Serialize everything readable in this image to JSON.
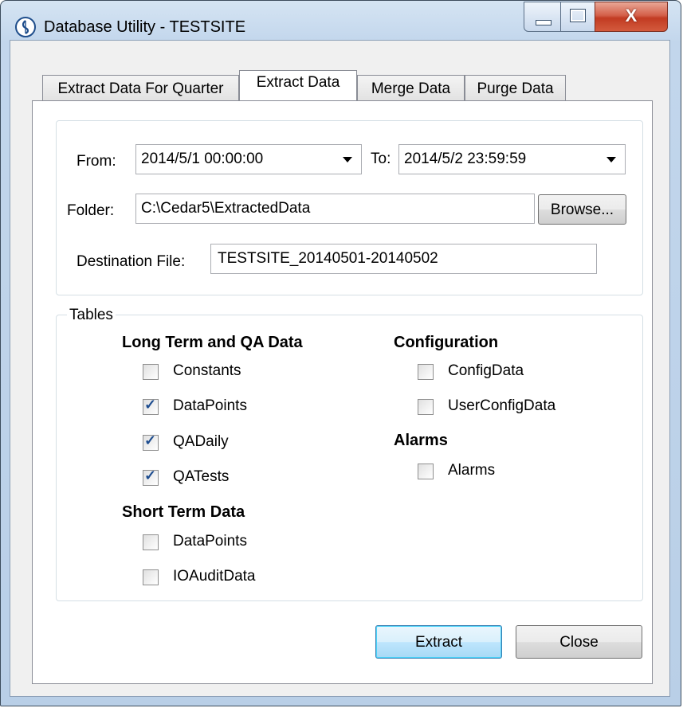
{
  "window": {
    "title": "Database Utility - TESTSITE",
    "close_symbol": "X"
  },
  "tabs": [
    {
      "label": "Extract Data For Quarter"
    },
    {
      "label": "Extract Data"
    },
    {
      "label": "Merge Data"
    },
    {
      "label": "Purge Data"
    }
  ],
  "range": {
    "from_label": "From:",
    "from_value": "2014/5/1 00:00:00",
    "to_label": "To:",
    "to_value": "2014/5/2 23:59:59"
  },
  "folder": {
    "label": "Folder:",
    "value": "C:\\Cedar5\\ExtractedData",
    "browse_label": "Browse..."
  },
  "destination": {
    "label": "Destination File:",
    "value": "TESTSITE_20140501-20140502"
  },
  "tables": {
    "caption": "Tables",
    "long_term": {
      "heading": "Long Term and QA Data",
      "items": [
        {
          "label": "Constants",
          "checked": false
        },
        {
          "label": "DataPoints",
          "checked": true
        },
        {
          "label": "QADaily",
          "checked": true
        },
        {
          "label": "QATests",
          "checked": true
        }
      ]
    },
    "short_term": {
      "heading": "Short Term Data",
      "items": [
        {
          "label": "DataPoints",
          "checked": false
        },
        {
          "label": "IOAuditData",
          "checked": false
        }
      ]
    },
    "configuration": {
      "heading": "Configuration",
      "items": [
        {
          "label": "ConfigData",
          "checked": false
        },
        {
          "label": "UserConfigData",
          "checked": false
        }
      ]
    },
    "alarms": {
      "heading": "Alarms",
      "items": [
        {
          "label": "Alarms",
          "checked": false
        }
      ]
    }
  },
  "actions": {
    "extract_label": "Extract",
    "close_label": "Close"
  },
  "colors": {
    "accent": "#3c7fb1",
    "close_button": "#c23b22",
    "check_mark": "#1d4c8f"
  }
}
